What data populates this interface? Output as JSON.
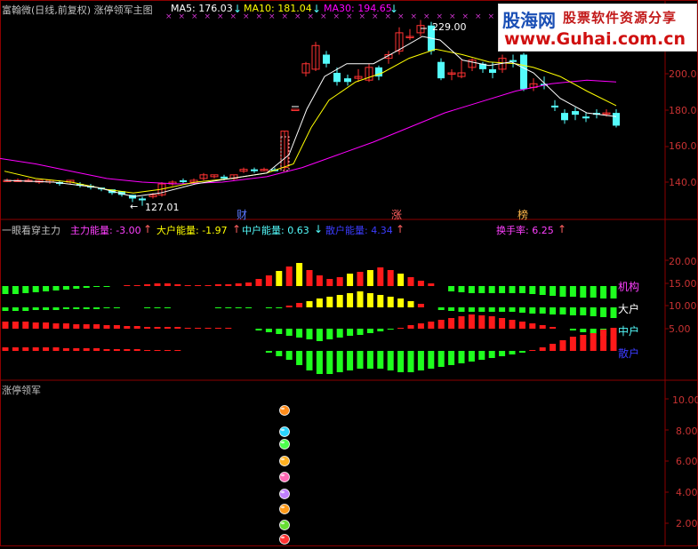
{
  "panel1": {
    "title": "富翰微(日线,前复权) 涨停领军主图",
    "ma5_label": "MA5: 176.03",
    "ma10_label": "MA10: 181.04",
    "ma30_label": "MA30: 194.65",
    "high_label": "229.00",
    "low_label": "127.01",
    "y_ticks": [
      "200.0",
      "180.0",
      "160.0",
      "140.0"
    ],
    "markers": [
      "财",
      "涨",
      "榜"
    ],
    "colors": {
      "ma5": "#ffffff",
      "ma10": "#ffff00",
      "ma30": "#ff00ff",
      "up": "#ff3232",
      "down": "#54fcfc"
    }
  },
  "panel2": {
    "title": "一眼看穿主力",
    "zhuli": "主力能量: -3.00",
    "dahu": "大户能量: -1.97",
    "zhonghu": "中户能量: 0.63",
    "sanhu": "散户能量: 4.34",
    "huanshou": "换手率: 6.25",
    "y_ticks": [
      "20.00",
      "15.00",
      "10.00",
      "5.00"
    ],
    "row_labels": [
      "机构",
      "大户",
      "中户",
      "散户"
    ]
  },
  "panel3": {
    "title": "涨停领军",
    "y_ticks": [
      "10.00",
      "8.00",
      "6.00",
      "4.00",
      "2.00"
    ]
  },
  "watermark": {
    "brand": "股海网",
    "slogan": "股票软件资源分享",
    "url": "www.Guhai.com.cn"
  }
}
